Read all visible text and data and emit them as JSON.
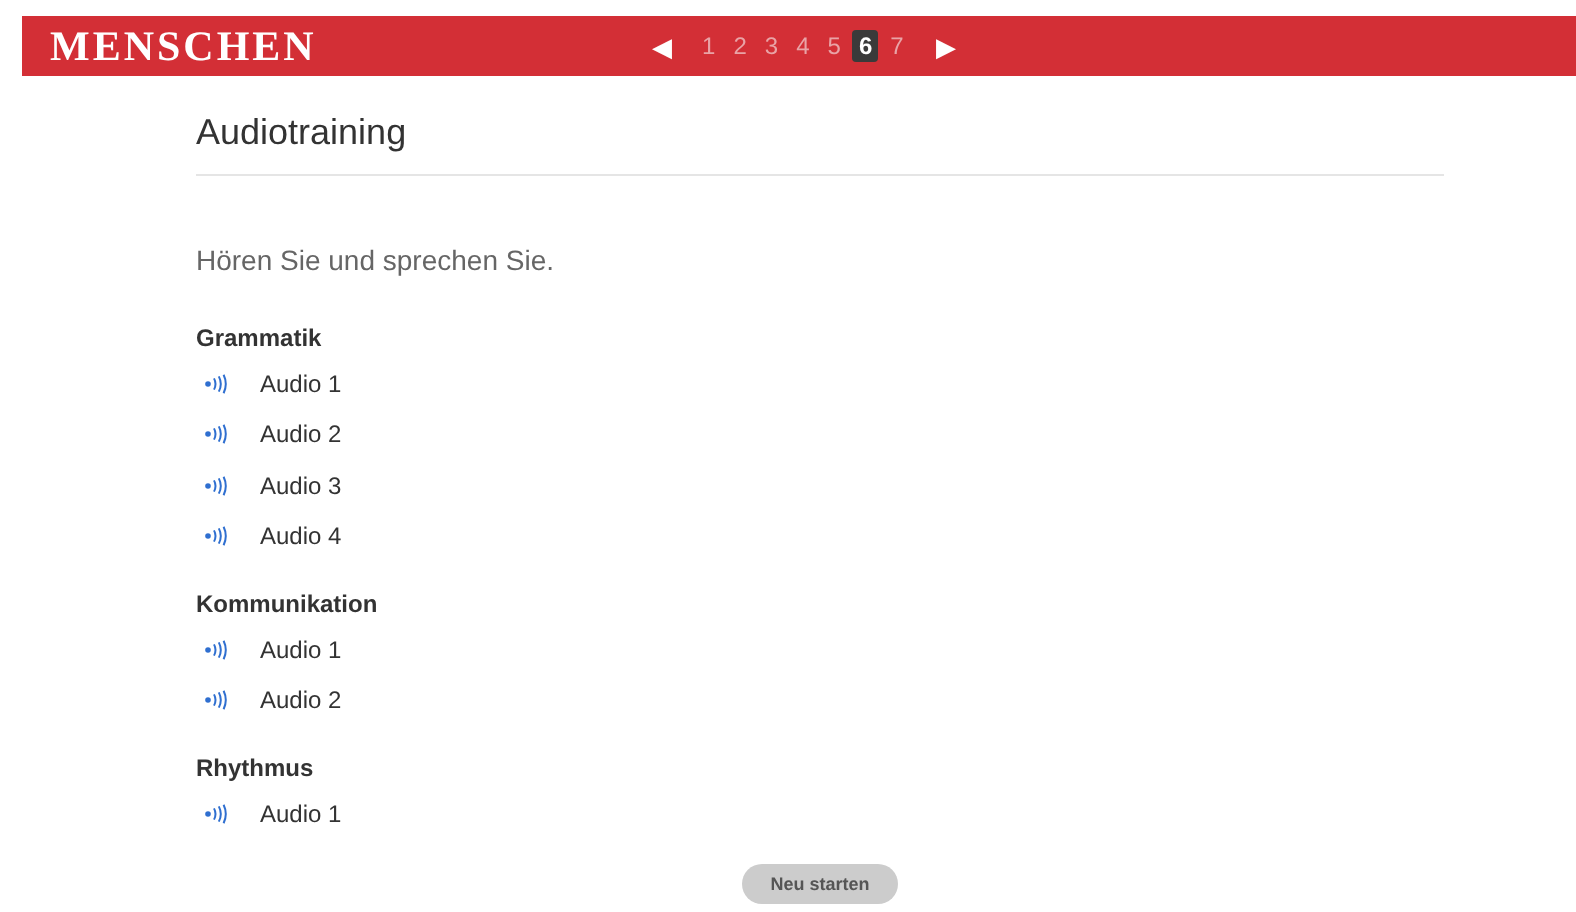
{
  "header": {
    "logo": "MENSCHEN",
    "pager": {
      "prev": "◀",
      "next": "▶",
      "pages": [
        {
          "label": "1",
          "selected": false
        },
        {
          "label": "2",
          "selected": false
        },
        {
          "label": "3",
          "selected": false
        },
        {
          "label": "4",
          "selected": false
        },
        {
          "label": "5",
          "selected": false
        },
        {
          "label": "6",
          "selected": true
        },
        {
          "label": "7",
          "selected": false
        }
      ]
    }
  },
  "title": "Audiotraining",
  "instruction": "Hören Sie und sprechen Sie.",
  "sections": [
    {
      "heading": "Grammatik",
      "items": [
        "Audio 1",
        "Audio 2",
        "Audio 3",
        "Audio 4"
      ]
    },
    {
      "heading": "Kommunikation",
      "items": [
        "Audio 1",
        "Audio 2"
      ]
    },
    {
      "heading": "Rhythmus",
      "items": [
        "Audio 1"
      ]
    }
  ],
  "button": "Neu starten"
}
